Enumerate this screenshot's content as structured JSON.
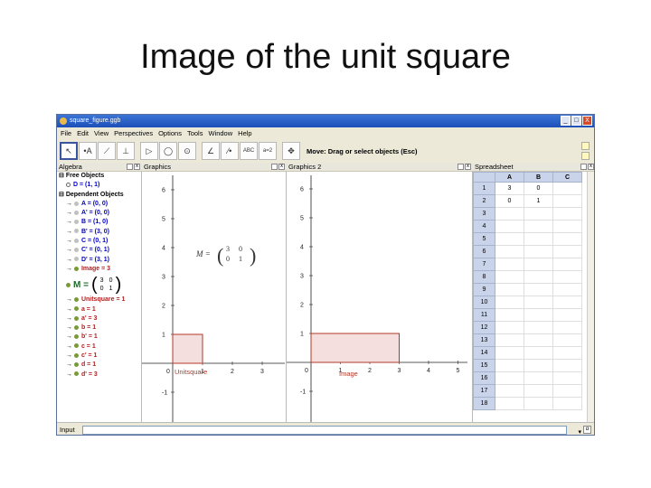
{
  "slide_title": "Image of the unit square",
  "window": {
    "title": "square_figure.ggb",
    "controls": [
      "_",
      "□",
      "X"
    ]
  },
  "menu": [
    "File",
    "Edit",
    "View",
    "Perspectives",
    "Options",
    "Tools",
    "Window",
    "Help"
  ],
  "toolbar": {
    "tools": [
      {
        "icon": "move-arrow-icon",
        "glyph": "↖"
      },
      {
        "icon": "new-point-icon",
        "glyph": "•A"
      },
      {
        "icon": "line-icon",
        "glyph": "⟋"
      },
      {
        "icon": "perpendicular-icon",
        "glyph": "⊥"
      },
      {
        "icon": "polygon-icon",
        "glyph": "▷"
      },
      {
        "icon": "circle-icon",
        "glyph": "◯"
      },
      {
        "icon": "circle-center-icon",
        "glyph": "⊙"
      },
      {
        "icon": "angle-icon",
        "glyph": "∠"
      },
      {
        "icon": "reflect-icon",
        "glyph": "⁄•"
      },
      {
        "icon": "text-abc-icon",
        "glyph": "ABC"
      },
      {
        "icon": "slider-icon",
        "glyph": "a=2"
      },
      {
        "icon": "move-view-icon",
        "glyph": "✥"
      }
    ],
    "hint": "Move: Drag or select objects (Esc)"
  },
  "panels": {
    "algebra": "Algebra",
    "graphics1": "Graphics",
    "graphics2": "Graphics 2",
    "spreadsheet": "Spreadsheet"
  },
  "algebra": {
    "free_header": "Free Objects",
    "free_items": [
      {
        "text": "D = (1, 1)",
        "color": "#0000cc"
      }
    ],
    "dep_header": "Dependent Objects",
    "dep_items": [
      {
        "text": "A = (0, 0)",
        "color": "#0000cc",
        "dot": "#c0c0c0"
      },
      {
        "text": "A' = (0, 0)",
        "color": "#0000cc",
        "dot": "#c0c0c0"
      },
      {
        "text": "B = (1, 0)",
        "color": "#0000cc",
        "dot": "#c0c0c0"
      },
      {
        "text": "B' = (3, 0)",
        "color": "#0000cc",
        "dot": "#c0c0c0"
      },
      {
        "text": "C = (0, 1)",
        "color": "#0000cc",
        "dot": "#c0c0c0"
      },
      {
        "text": "C' = (0, 1)",
        "color": "#0000cc",
        "dot": "#c0c0c0"
      },
      {
        "text": "D' = (3, 1)",
        "color": "#0000cc",
        "dot": "#c0c0c0"
      },
      {
        "text": "Image = 3",
        "color": "#b02020",
        "dot": "#7a9a3a"
      }
    ],
    "matrix": {
      "label": "M =",
      "cells": [
        "3",
        "0",
        "0",
        "1"
      ]
    },
    "dep_items2": [
      {
        "text": "Unitsquare = 1",
        "color": "#b02020",
        "dot": "#7a9a3a"
      },
      {
        "text": "a = 1",
        "color": "#b02020",
        "dot": "#7a9a3a"
      },
      {
        "text": "a' = 3",
        "color": "#b02020",
        "dot": "#7a9a3a"
      },
      {
        "text": "b = 1",
        "color": "#b02020",
        "dot": "#7a9a3a"
      },
      {
        "text": "b' = 1",
        "color": "#b02020",
        "dot": "#7a9a3a"
      },
      {
        "text": "c = 1",
        "color": "#b02020",
        "dot": "#7a9a3a"
      },
      {
        "text": "c' = 1",
        "color": "#b02020",
        "dot": "#7a9a3a"
      },
      {
        "text": "d = 1",
        "color": "#b02020",
        "dot": "#7a9a3a"
      },
      {
        "text": "d' = 3",
        "color": "#b02020",
        "dot": "#7a9a3a"
      }
    ]
  },
  "graphics1": {
    "x_ticks": [
      "0",
      "1",
      "2",
      "3"
    ],
    "y_ticks": [
      "6",
      "5",
      "4",
      "3",
      "2",
      "1",
      "-1"
    ],
    "polygon_label": "Unitsquare",
    "matrix_text": {
      "label": "M =",
      "cells": [
        "3",
        "0",
        "0",
        "1"
      ]
    }
  },
  "graphics2": {
    "x_ticks": [
      "0",
      "1",
      "2",
      "3",
      "4",
      "5"
    ],
    "y_ticks": [
      "6",
      "5",
      "4",
      "3",
      "2",
      "1",
      "-1"
    ],
    "polygon_label": "Image"
  },
  "spreadsheet": {
    "columns": [
      "A",
      "B",
      "C"
    ],
    "rows": [
      [
        "1",
        "3",
        "0",
        ""
      ],
      [
        "2",
        "0",
        "1",
        ""
      ],
      [
        "3",
        "",
        "",
        ""
      ],
      [
        "4",
        "",
        "",
        ""
      ],
      [
        "5",
        "",
        "",
        ""
      ],
      [
        "6",
        "",
        "",
        ""
      ],
      [
        "7",
        "",
        "",
        ""
      ],
      [
        "8",
        "",
        "",
        ""
      ],
      [
        "9",
        "",
        "",
        ""
      ],
      [
        "10",
        "",
        "",
        ""
      ],
      [
        "11",
        "",
        "",
        ""
      ],
      [
        "12",
        "",
        "",
        ""
      ],
      [
        "13",
        "",
        "",
        ""
      ],
      [
        "14",
        "",
        "",
        ""
      ],
      [
        "15",
        "",
        "",
        ""
      ],
      [
        "16",
        "",
        "",
        ""
      ],
      [
        "17",
        "",
        "",
        ""
      ],
      [
        "18",
        "",
        "",
        ""
      ]
    ]
  },
  "inputbar": {
    "label": "Input"
  },
  "colors": {
    "polygon_fill": "#f5dede",
    "polygon_stroke": "#b03a2a",
    "polygon_label": "#b03a2a",
    "axis": "#222222"
  }
}
